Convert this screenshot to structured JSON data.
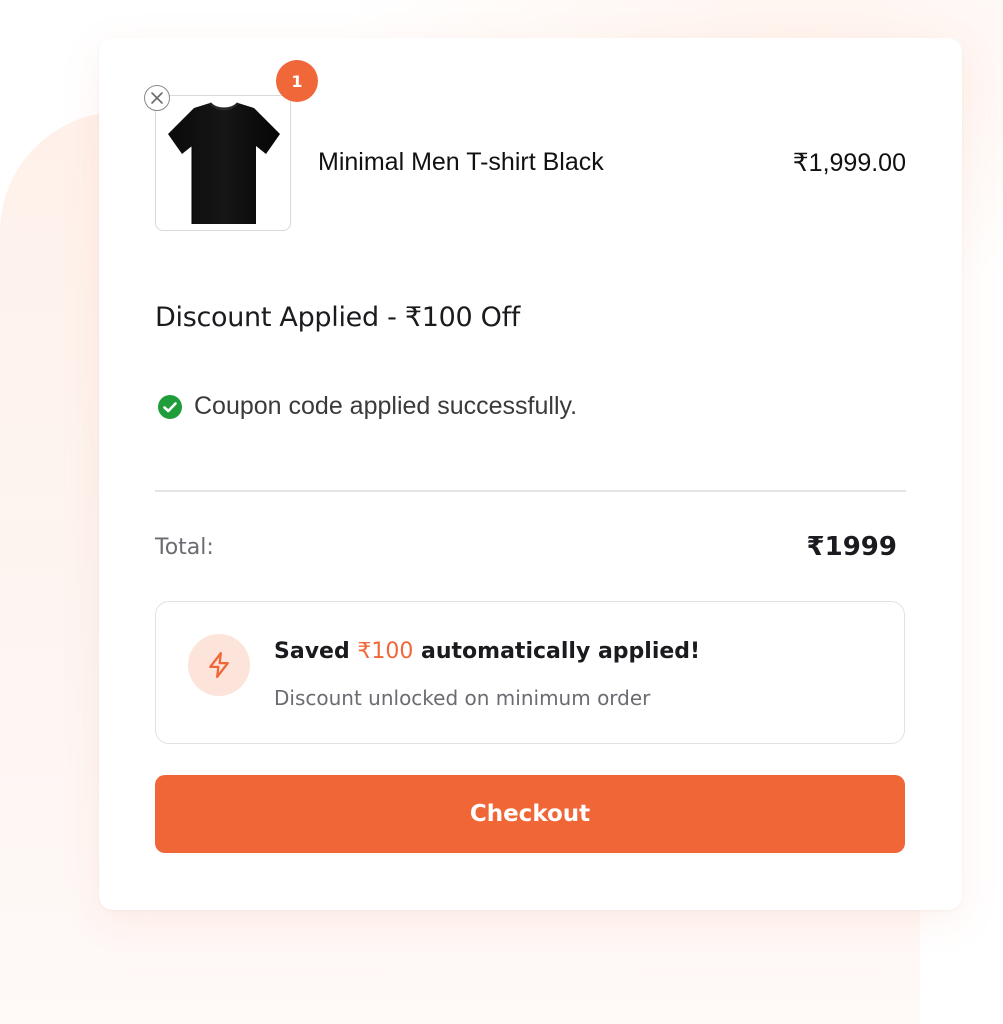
{
  "cart": {
    "item": {
      "name": "Minimal Men T-shirt Black",
      "price": "₹1,999.00",
      "quantity": "1",
      "image_icon": "tshirt-image"
    },
    "discount_title": "Discount Applied - ₹100 Off",
    "coupon_status": "Coupon code applied successfully.",
    "total_label": "Total:",
    "total_value": "₹1999",
    "savings": {
      "prefix": "Saved ",
      "amount": "₹100",
      "suffix": " automatically applied!",
      "subtitle": "Discount unlocked on minimum order",
      "icon": "lightning-bolt-icon"
    },
    "checkout_label": "Checkout"
  },
  "colors": {
    "accent": "#f0673a",
    "success": "#1f9d3a",
    "bolt_bg": "#fde4da"
  }
}
